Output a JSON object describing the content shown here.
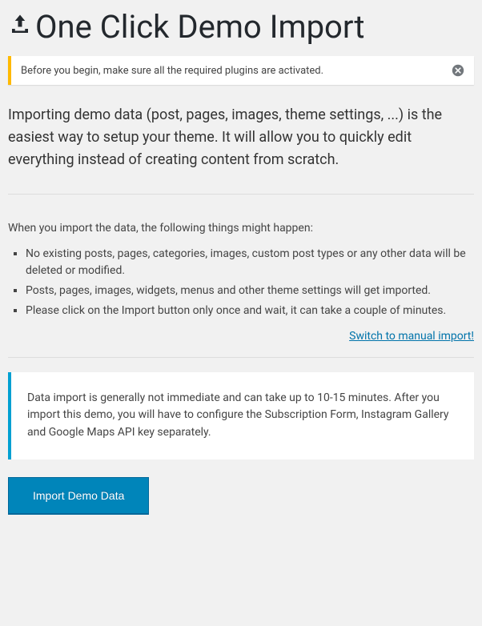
{
  "header": {
    "title": "One Click Demo Import"
  },
  "notice": {
    "text": "Before you begin, make sure all the required plugins are activated."
  },
  "intro": {
    "paragraph": "Importing demo data (post, pages, images, theme settings, ...) is the easiest way to setup your theme. It will allow you to quickly edit everything instead of creating content from scratch."
  },
  "things": {
    "heading": "When you import the data, the following things might happen:",
    "items": [
      "No existing posts, pages, categories, images, custom post types or any other data will be deleted or modified.",
      "Posts, pages, images, widgets, menus and other theme settings will get imported.",
      "Please click on the Import button only once and wait, it can take a couple of minutes."
    ]
  },
  "switch_link": {
    "label": "Switch to manual import!"
  },
  "info_box": {
    "text": "Data import is generally not immediate and can take up to 10-15 minutes. After you import this demo, you will have to configure the Subscription Form, Instagram Gallery and Google Maps API key separately."
  },
  "actions": {
    "import_button_label": "Import Demo Data"
  }
}
